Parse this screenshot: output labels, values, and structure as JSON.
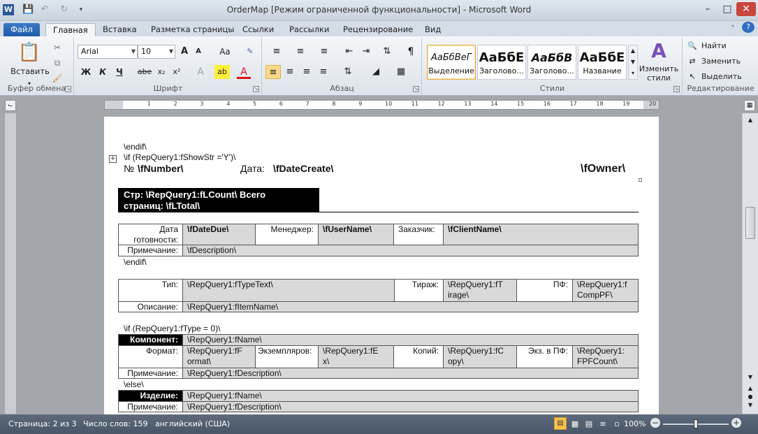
{
  "window": {
    "title": "OrderMap [Режим ограниченной функциональности]  -  Microsoft Word"
  },
  "quick_access": [
    "word-logo-icon",
    "save-icon",
    "undo-icon",
    "redo-icon",
    "customize-icon"
  ],
  "tabs": {
    "file": "Файл",
    "items": [
      "Главная",
      "Вставка",
      "Разметка страницы",
      "Ссылки",
      "Рассылки",
      "Рецензирование",
      "Вид"
    ],
    "active": "Главная"
  },
  "ribbon": {
    "clipboard": {
      "paste": "Вставить",
      "label": "Буфер обмена"
    },
    "font": {
      "name": "Arial",
      "size": "10",
      "label": "Шрифт",
      "bold": "Ж",
      "italic": "К",
      "underline": "Ч",
      "strike": "abe",
      "sub": "x₂",
      "sup": "x²",
      "grow": "A",
      "shrink": "A",
      "case": "Aa",
      "color": "A",
      "highlight": "ab"
    },
    "paragraph": {
      "label": "Абзац",
      "pilcrow": "¶"
    },
    "styles": {
      "label": "Стили",
      "items": [
        {
          "preview": "АаБбВеГ",
          "name": "Выделение"
        },
        {
          "preview": "АаБбЕ",
          "name": "Заголово..."
        },
        {
          "preview": "АаБбВ",
          "name": "Заголово..."
        },
        {
          "preview": "АаБбЕ",
          "name": "Название"
        }
      ],
      "change": "Изменить стили"
    },
    "editing": {
      "label": "Редактирование",
      "find": "Найти",
      "replace": "Заменить",
      "select": "Выделить"
    }
  },
  "ruler": {
    "numbers": [
      "1",
      "2",
      "1",
      "2",
      "3",
      "4",
      "5",
      "6",
      "7",
      "8",
      "9",
      "10",
      "11",
      "12",
      "13",
      "14",
      "15",
      "16",
      "17",
      "18",
      "19",
      "20"
    ]
  },
  "document": {
    "endif1": "\\endif\\",
    "if_show": "\\if (RepQuery1:fShowStr ='Y')\\",
    "number_label": "№",
    "number_field": "\\fNumber\\",
    "date_label": "Дата:",
    "date_field": "\\fDateCreate\\",
    "owner": "\\fOwner\\",
    "page_header_1": "Стр: \\RepQuery1:fLCount\\  Всего",
    "page_header_2": "страниц: \\fLTotal\\",
    "t1": {
      "due_label": "Дата готовности:",
      "due_value": "\\fDateDue\\",
      "manager_label": "Менеджер:",
      "manager_value": "\\fUserName\\",
      "client_label": "Заказчик:",
      "client_value": "\\fClientName\\",
      "note_label": "Примечание:",
      "note_value": "\\fDescription\\"
    },
    "endif2": "\\endif\\",
    "t2": {
      "type_label": "Тип:",
      "type_value": "\\RepQuery1:fTypeText\\",
      "run_label": "Тираж:",
      "run_value_1": "\\RepQuery1:fT",
      "run_value_2": "irage\\",
      "pf_label": "ПФ:",
      "pf_value_1": "\\RepQuery1:f",
      "pf_value_2": "CompPF\\",
      "desc_label": "Описание:",
      "desc_value": "\\RepQuery1:fItemName\\"
    },
    "if_type": "\\if (RepQuery1:fType = 0)\\",
    "t3": {
      "component_label": "Компонент:",
      "component_value": "\\RepQuery1:fName\\",
      "format_label": "Формат:",
      "format_value_1": "\\RepQuery1:fF",
      "format_value_2": "ormat\\",
      "copies_label": "Экземпляров:",
      "copies_value_1": "\\RepQuery1:fE",
      "copies_value_2": "x\\",
      "cop_label": "Копий:",
      "cop_value_1": "\\RepQuery1:fC",
      "cop_value_2": "opy\\",
      "expf_label": "Экз. в ПФ:",
      "expf_value_1": "\\RepQuery1:",
      "expf_value_2": "FPFCount\\",
      "note_label": "Примечание:",
      "note_value": "\\RepQuery1:fDescription\\"
    },
    "else": "\\else\\",
    "t4": {
      "item_label": "Изделие:",
      "item_value": "\\RepQuery1:fName\\",
      "note_label": "Примечание:",
      "note_value": "\\RepQuery1:fDescription\\"
    }
  },
  "status": {
    "page": "Страница: 2 из 3",
    "words": "Число слов: 159",
    "lang": "английский (США)",
    "zoom": "100%"
  }
}
